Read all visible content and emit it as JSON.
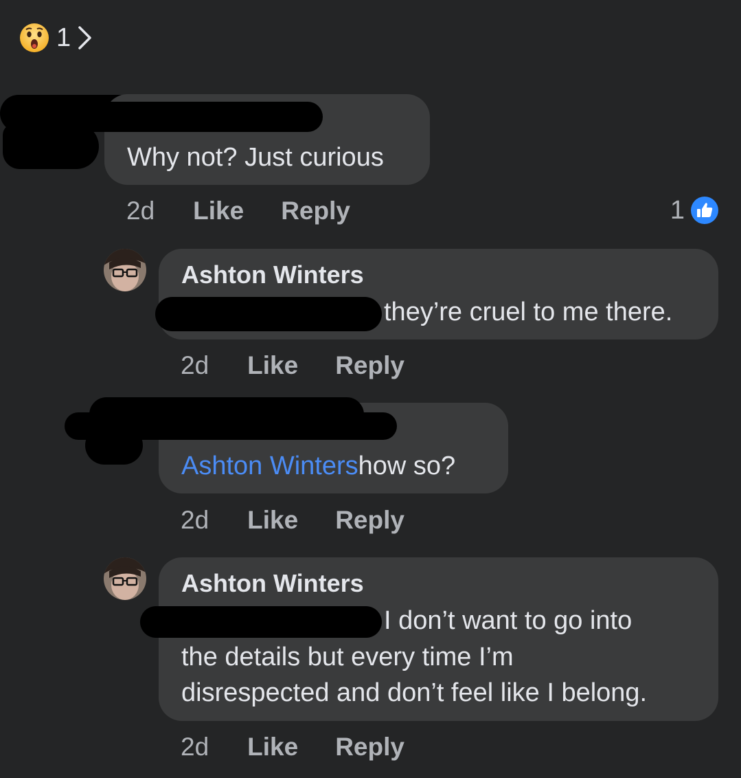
{
  "reaction_summary": {
    "icon": "wow-emoji-icon",
    "count": "1"
  },
  "comments": [
    {
      "text": "Why not? Just curious",
      "time": "2d",
      "like_label": "Like",
      "reply_label": "Reply",
      "like_count": "1"
    },
    {
      "author": "Ashton Winters",
      "text": "they’re cruel to me there.",
      "time": "2d",
      "like_label": "Like",
      "reply_label": "Reply"
    },
    {
      "mention": "Ashton Winters",
      "text": "how so?",
      "time": "2d",
      "like_label": "Like",
      "reply_label": "Reply"
    },
    {
      "author": "Ashton Winters",
      "text_lines": [
        "I don’t want to go into",
        "the details but every time I’m",
        "disrespected and don’t feel like I belong."
      ],
      "time": "2d",
      "like_label": "Like",
      "reply_label": "Reply"
    }
  ],
  "colors": {
    "background": "#242526",
    "bubble": "#3a3b3c",
    "mention": "#4b8cf5",
    "like_blue": "#2d88ff"
  }
}
